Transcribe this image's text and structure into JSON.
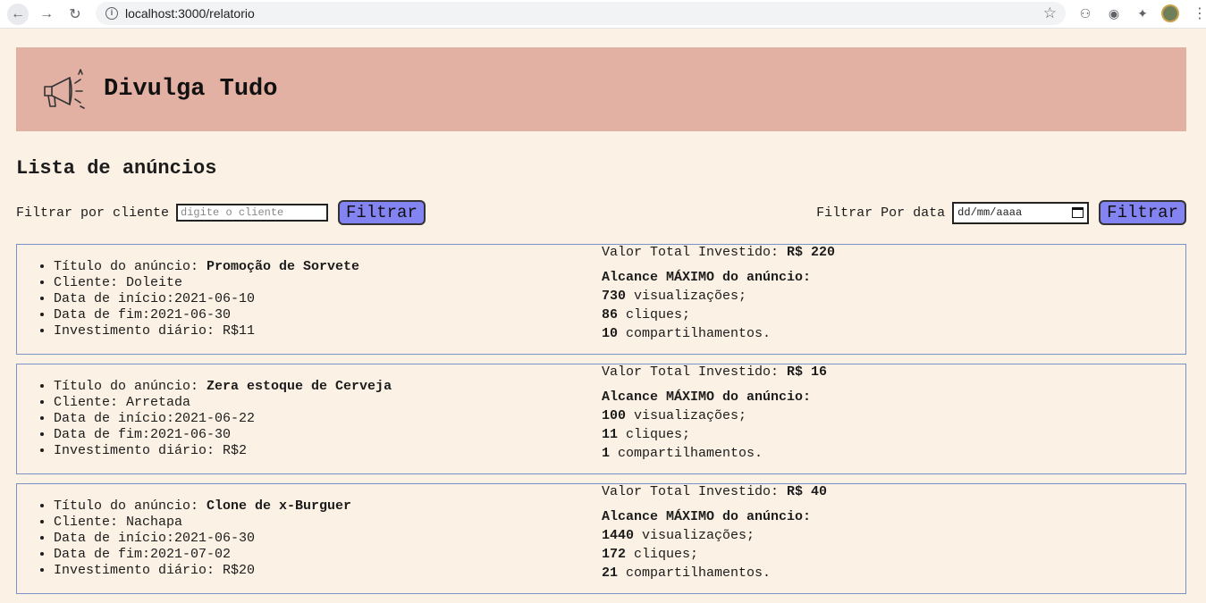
{
  "browser": {
    "url": "localhost:3000/relatorio"
  },
  "header": {
    "brand": "Divulga Tudo",
    "logo_icon": "megaphone-icon"
  },
  "page": {
    "title": "Lista de anúncios"
  },
  "filters": {
    "client_label": "Filtrar por cliente",
    "client_placeholder": "digite o cliente",
    "client_button": "Filtrar",
    "date_label": "Filtrar Por data",
    "date_placeholder": "dd/mm/aaaa",
    "date_button": "Filtrar"
  },
  "labels": {
    "title": "Título do anúncio: ",
    "client": "Cliente: ",
    "start": "Data de início:",
    "end": "Data de fim:",
    "daily": "Investimento diário: ",
    "total": "Valor Total Investido: ",
    "reach": "Alcance MÁXIMO do anúncio:",
    "views_suffix": " visualizações;",
    "clicks_suffix": " cliques;",
    "shares_suffix": " compartilhamentos."
  },
  "ads": [
    {
      "title": "Promoção de Sorvete",
      "client": "Doleite",
      "start": "2021-06-10",
      "end": "2021-06-30",
      "daily": "R$11",
      "total": "R$ 220",
      "views": "730",
      "clicks": "86",
      "shares": "10"
    },
    {
      "title": "Zera estoque de Cerveja",
      "client": "Arretada",
      "start": "2021-06-22",
      "end": "2021-06-30",
      "daily": "R$2",
      "total": "R$ 16",
      "views": "100",
      "clicks": "11",
      "shares": "1"
    },
    {
      "title": "Clone de x-Burguer",
      "client": "Nachapa",
      "start": "2021-06-30",
      "end": "2021-07-02",
      "daily": "R$20",
      "total": "R$ 40",
      "views": "1440",
      "clicks": "172",
      "shares": "21"
    }
  ]
}
